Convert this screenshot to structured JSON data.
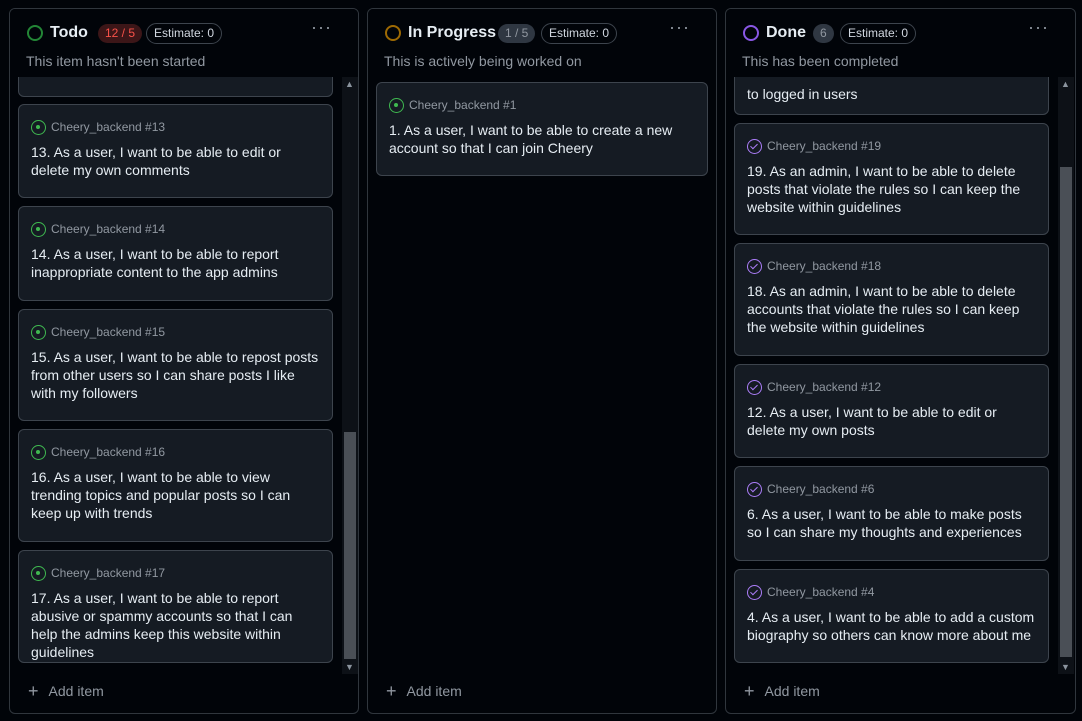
{
  "columns": [
    {
      "title": "Todo",
      "count": "12 / 5",
      "estimate": "Estimate: 0",
      "description": "This item hasn't been started",
      "add_item": "Add item",
      "status_color": "#238636",
      "cards": [
        {
          "repo": "",
          "text": ""
        },
        {
          "repo": "Cheery_backend #13",
          "text": "13. As a user, I want to be able to edit or delete my own comments"
        },
        {
          "repo": "Cheery_backend #14",
          "text": "14. As a user, I want to be able to report inappropriate content to the app admins"
        },
        {
          "repo": "Cheery_backend #15",
          "text": "15. As a user, I want to be able to repost posts from other users so I can share posts I like with my followers"
        },
        {
          "repo": "Cheery_backend #16",
          "text": "16. As a user, I want to be able to view trending topics and popular posts so I can keep up with trends"
        },
        {
          "repo": "Cheery_backend #17",
          "text": "17. As a user, I want to be able to report abusive or spammy accounts so that I can help the admins keep this website within guidelines"
        }
      ]
    },
    {
      "title": "In Progress",
      "count": "1 / 5",
      "estimate": "Estimate: 0",
      "description": "This is actively being worked on",
      "add_item": "Add item",
      "status_color": "#9e6a03",
      "cards": [
        {
          "repo": "Cheery_backend #1",
          "text": "1. As a user, I want to be able to create a new account so that I can join Cheery"
        }
      ]
    },
    {
      "title": "Done",
      "count": "6",
      "estimate": "Estimate: 0",
      "description": "This has been completed",
      "add_item": "Add item",
      "status_color": "#8957e5",
      "cards": [
        {
          "repo": "",
          "text": "to logged in users"
        },
        {
          "repo": "Cheery_backend #19",
          "text": "19. As an admin, I want to be able to delete posts that violate the rules so I can keep the website within guidelines"
        },
        {
          "repo": "Cheery_backend #18",
          "text": "18. As an admin, I want to be able to delete accounts that violate the rules so I can keep the website within guidelines"
        },
        {
          "repo": "Cheery_backend #12",
          "text": "12. As a user, I want to be able to edit or delete my own posts"
        },
        {
          "repo": "Cheery_backend #6",
          "text": "6. As a user, I want to be able to make posts so I can share my thoughts and experiences"
        },
        {
          "repo": "Cheery_backend #4",
          "text": "4. As a user, I want to be able to add a custom biography so others can know more about me"
        }
      ]
    }
  ],
  "colors": {
    "over_limit_badge_bg": "#3c1618",
    "over_limit_badge_fg": "#f85149",
    "badge_bg": "#2f3742",
    "badge_fg": "#9198a1",
    "open_issue": "#3fb950",
    "closed_issue": "#ab7df8"
  },
  "icons": {
    "more": "kebab-horizontal",
    "add": "plus",
    "open_issue": "issue-opened",
    "closed_issue": "issue-closed"
  }
}
